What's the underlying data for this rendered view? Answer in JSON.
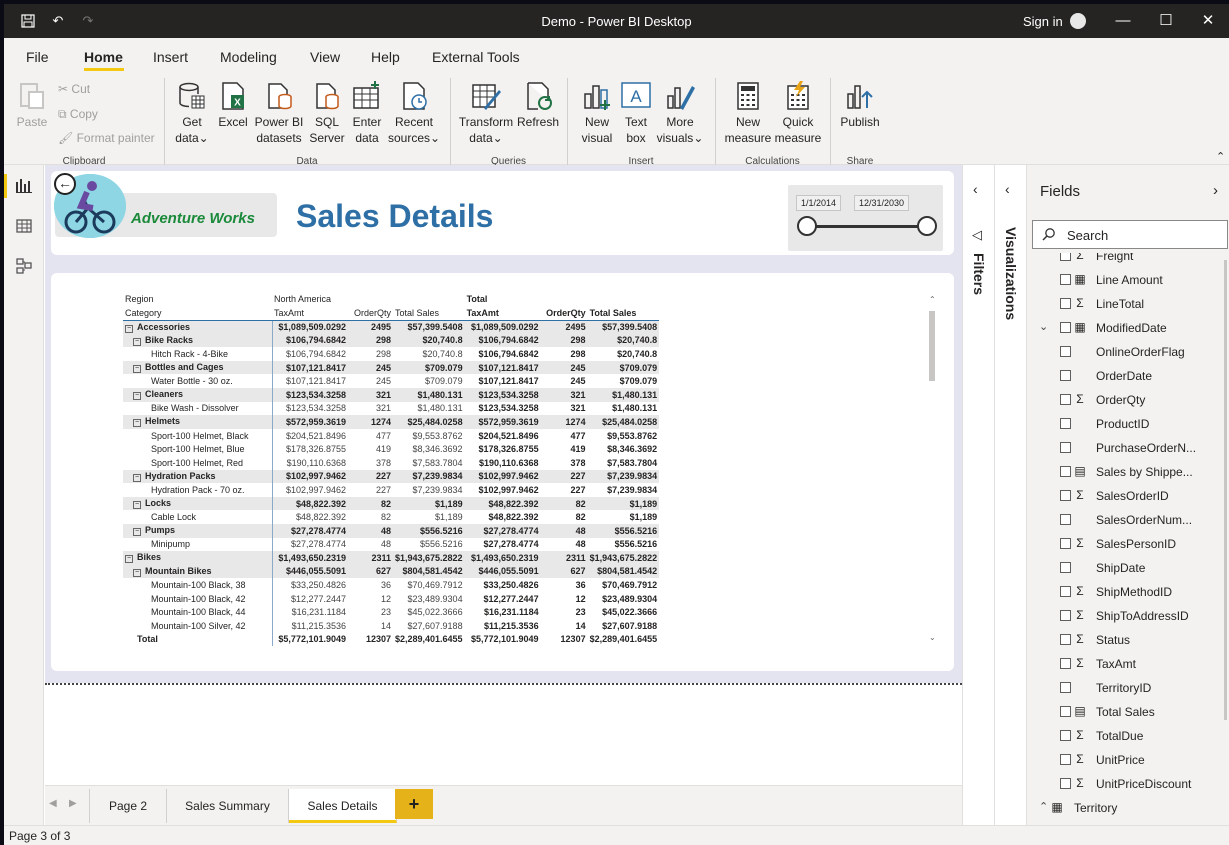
{
  "window": {
    "title": "Demo - Power BI Desktop",
    "sign_in": "Sign in"
  },
  "menu_tabs": [
    "File",
    "Home",
    "Insert",
    "Modeling",
    "View",
    "Help",
    "External Tools"
  ],
  "ribbon": {
    "clipboard": {
      "paste": "Paste",
      "cut": "Cut",
      "copy": "Copy",
      "format_painter": "Format painter",
      "group": "Clipboard"
    },
    "data": {
      "get_data": [
        "Get",
        "data"
      ],
      "excel": "Excel",
      "pbi_datasets": [
        "Power BI",
        "datasets"
      ],
      "sql": [
        "SQL",
        "Server"
      ],
      "enter_data": [
        "Enter",
        "data"
      ],
      "recent": [
        "Recent",
        "sources"
      ],
      "group": "Data"
    },
    "queries": {
      "transform": [
        "Transform",
        "data"
      ],
      "refresh": "Refresh",
      "group": "Queries"
    },
    "insert": {
      "new_visual": [
        "New",
        "visual"
      ],
      "text_box": [
        "Text",
        "box"
      ],
      "more_visuals": [
        "More",
        "visuals"
      ],
      "group": "Insert"
    },
    "calculations": {
      "new_measure": [
        "New",
        "measure"
      ],
      "quick_measure": [
        "Quick",
        "measure"
      ],
      "group": "Calculations"
    },
    "share": {
      "publish": "Publish",
      "group": "Share"
    }
  },
  "report": {
    "logo_text": "Adventure Works",
    "title": "Sales Details",
    "slicer": {
      "start": "1/1/2014",
      "end": "12/31/2030",
      "start_pos": 0.0,
      "end_pos": 1.0
    }
  },
  "matrix": {
    "header1": [
      "Region",
      "North America",
      "",
      "",
      "Total",
      "",
      ""
    ],
    "header2": [
      "Category",
      "TaxAmt",
      "OrderQty",
      "Total Sales",
      "TaxAmt",
      "OrderQty",
      "Total Sales"
    ],
    "rows": [
      {
        "level": 0,
        "exp": true,
        "label": "Accessories",
        "v": [
          "$1,089,509.0292",
          "2495",
          "$57,399.5408",
          "$1,089,509.0292",
          "2495",
          "$57,399.5408"
        ]
      },
      {
        "level": 1,
        "exp": true,
        "label": "Bike Racks",
        "v": [
          "$106,794.6842",
          "298",
          "$20,740.8",
          "$106,794.6842",
          "298",
          "$20,740.8"
        ]
      },
      {
        "level": 2,
        "exp": false,
        "label": "Hitch Rack - 4-Bike",
        "v": [
          "$106,794.6842",
          "298",
          "$20,740.8",
          "$106,794.6842",
          "298",
          "$20,740.8"
        ]
      },
      {
        "level": 1,
        "exp": true,
        "label": "Bottles and Cages",
        "v": [
          "$107,121.8417",
          "245",
          "$709.079",
          "$107,121.8417",
          "245",
          "$709.079"
        ]
      },
      {
        "level": 2,
        "exp": false,
        "label": "Water Bottle - 30 oz.",
        "v": [
          "$107,121.8417",
          "245",
          "$709.079",
          "$107,121.8417",
          "245",
          "$709.079"
        ]
      },
      {
        "level": 1,
        "exp": true,
        "label": "Cleaners",
        "v": [
          "$123,534.3258",
          "321",
          "$1,480.131",
          "$123,534.3258",
          "321",
          "$1,480.131"
        ]
      },
      {
        "level": 2,
        "exp": false,
        "label": "Bike Wash - Dissolver",
        "v": [
          "$123,534.3258",
          "321",
          "$1,480.131",
          "$123,534.3258",
          "321",
          "$1,480.131"
        ]
      },
      {
        "level": 1,
        "exp": true,
        "label": "Helmets",
        "v": [
          "$572,959.3619",
          "1274",
          "$25,484.0258",
          "$572,959.3619",
          "1274",
          "$25,484.0258"
        ]
      },
      {
        "level": 2,
        "exp": false,
        "label": "Sport-100 Helmet, Black",
        "v": [
          "$204,521.8496",
          "477",
          "$9,553.8762",
          "$204,521.8496",
          "477",
          "$9,553.8762"
        ]
      },
      {
        "level": 2,
        "exp": false,
        "label": "Sport-100 Helmet, Blue",
        "v": [
          "$178,326.8755",
          "419",
          "$8,346.3692",
          "$178,326.8755",
          "419",
          "$8,346.3692"
        ]
      },
      {
        "level": 2,
        "exp": false,
        "label": "Sport-100 Helmet, Red",
        "v": [
          "$190,110.6368",
          "378",
          "$7,583.7804",
          "$190,110.6368",
          "378",
          "$7,583.7804"
        ]
      },
      {
        "level": 1,
        "exp": true,
        "label": "Hydration Packs",
        "v": [
          "$102,997.9462",
          "227",
          "$7,239.9834",
          "$102,997.9462",
          "227",
          "$7,239.9834"
        ]
      },
      {
        "level": 2,
        "exp": false,
        "label": "Hydration Pack - 70 oz.",
        "v": [
          "$102,997.9462",
          "227",
          "$7,239.9834",
          "$102,997.9462",
          "227",
          "$7,239.9834"
        ]
      },
      {
        "level": 1,
        "exp": true,
        "label": "Locks",
        "v": [
          "$48,822.392",
          "82",
          "$1,189",
          "$48,822.392",
          "82",
          "$1,189"
        ]
      },
      {
        "level": 2,
        "exp": false,
        "label": "Cable Lock",
        "v": [
          "$48,822.392",
          "82",
          "$1,189",
          "$48,822.392",
          "82",
          "$1,189"
        ]
      },
      {
        "level": 1,
        "exp": true,
        "label": "Pumps",
        "v": [
          "$27,278.4774",
          "48",
          "$556.5216",
          "$27,278.4774",
          "48",
          "$556.5216"
        ]
      },
      {
        "level": 2,
        "exp": false,
        "label": "Minipump",
        "v": [
          "$27,278.4774",
          "48",
          "$556.5216",
          "$27,278.4774",
          "48",
          "$556.5216"
        ]
      },
      {
        "level": 0,
        "exp": true,
        "label": "Bikes",
        "v": [
          "$1,493,650.2319",
          "2311",
          "$1,943,675.2822",
          "$1,493,650.2319",
          "2311",
          "$1,943,675.2822"
        ]
      },
      {
        "level": 1,
        "exp": true,
        "label": "Mountain Bikes",
        "v": [
          "$446,055.5091",
          "627",
          "$804,581.4542",
          "$446,055.5091",
          "627",
          "$804,581.4542"
        ]
      },
      {
        "level": 2,
        "exp": false,
        "label": "Mountain-100 Black, 38",
        "v": [
          "$33,250.4826",
          "36",
          "$70,469.7912",
          "$33,250.4826",
          "36",
          "$70,469.7912"
        ]
      },
      {
        "level": 2,
        "exp": false,
        "label": "Mountain-100 Black, 42",
        "v": [
          "$12,277.2447",
          "12",
          "$23,489.9304",
          "$12,277.2447",
          "12",
          "$23,489.9304"
        ]
      },
      {
        "level": 2,
        "exp": false,
        "label": "Mountain-100 Black, 44",
        "v": [
          "$16,231.1184",
          "23",
          "$45,022.3666",
          "$16,231.1184",
          "23",
          "$45,022.3666"
        ]
      },
      {
        "level": 2,
        "exp": false,
        "label": "Mountain-100 Silver, 42",
        "v": [
          "$11,215.3536",
          "14",
          "$27,607.9188",
          "$11,215.3536",
          "14",
          "$27,607.9188"
        ]
      },
      {
        "level": 0,
        "exp": false,
        "label": "Total",
        "total": true,
        "v": [
          "$5,772,101.9049",
          "12307",
          "$2,289,401.6455",
          "$5,772,101.9049",
          "12307",
          "$2,289,401.6455"
        ]
      }
    ]
  },
  "page_tabs": [
    "Page 2",
    "Sales Summary",
    "Sales Details"
  ],
  "status": "Page 3 of 3",
  "panes": {
    "filters": "Filters",
    "visualizations": "Visualizations",
    "fields": "Fields",
    "search_placeholder": "Search"
  },
  "fields": [
    {
      "name": "Freight",
      "type": "sigma",
      "cut": true
    },
    {
      "name": "Line Amount",
      "type": "table"
    },
    {
      "name": "LineTotal",
      "type": "sigma"
    },
    {
      "name": "ModifiedDate",
      "type": "calendar",
      "expand": true
    },
    {
      "name": "OnlineOrderFlag",
      "type": ""
    },
    {
      "name": "OrderDate",
      "type": ""
    },
    {
      "name": "OrderQty",
      "type": "sigma"
    },
    {
      "name": "ProductID",
      "type": ""
    },
    {
      "name": "PurchaseOrderN...",
      "type": ""
    },
    {
      "name": "Sales by Shippe...",
      "type": "calc"
    },
    {
      "name": "SalesOrderID",
      "type": "sigma"
    },
    {
      "name": "SalesOrderNum...",
      "type": ""
    },
    {
      "name": "SalesPersonID",
      "type": "sigma"
    },
    {
      "name": "ShipDate",
      "type": ""
    },
    {
      "name": "ShipMethodID",
      "type": "sigma"
    },
    {
      "name": "ShipToAddressID",
      "type": "sigma"
    },
    {
      "name": "Status",
      "type": "sigma"
    },
    {
      "name": "TaxAmt",
      "type": "sigma"
    },
    {
      "name": "TerritoryID",
      "type": ""
    },
    {
      "name": "Total Sales",
      "type": "calc"
    },
    {
      "name": "TotalDue",
      "type": "sigma"
    },
    {
      "name": "UnitPrice",
      "type": "sigma"
    },
    {
      "name": "UnitPriceDiscount",
      "type": "sigma"
    },
    {
      "name": "Territory",
      "type": "table",
      "group": true
    }
  ],
  "colors": {
    "accent": "#f2c811",
    "title": "#2e6fa6",
    "logo": "#1a8a3a",
    "add_page": "#e6b21a"
  }
}
